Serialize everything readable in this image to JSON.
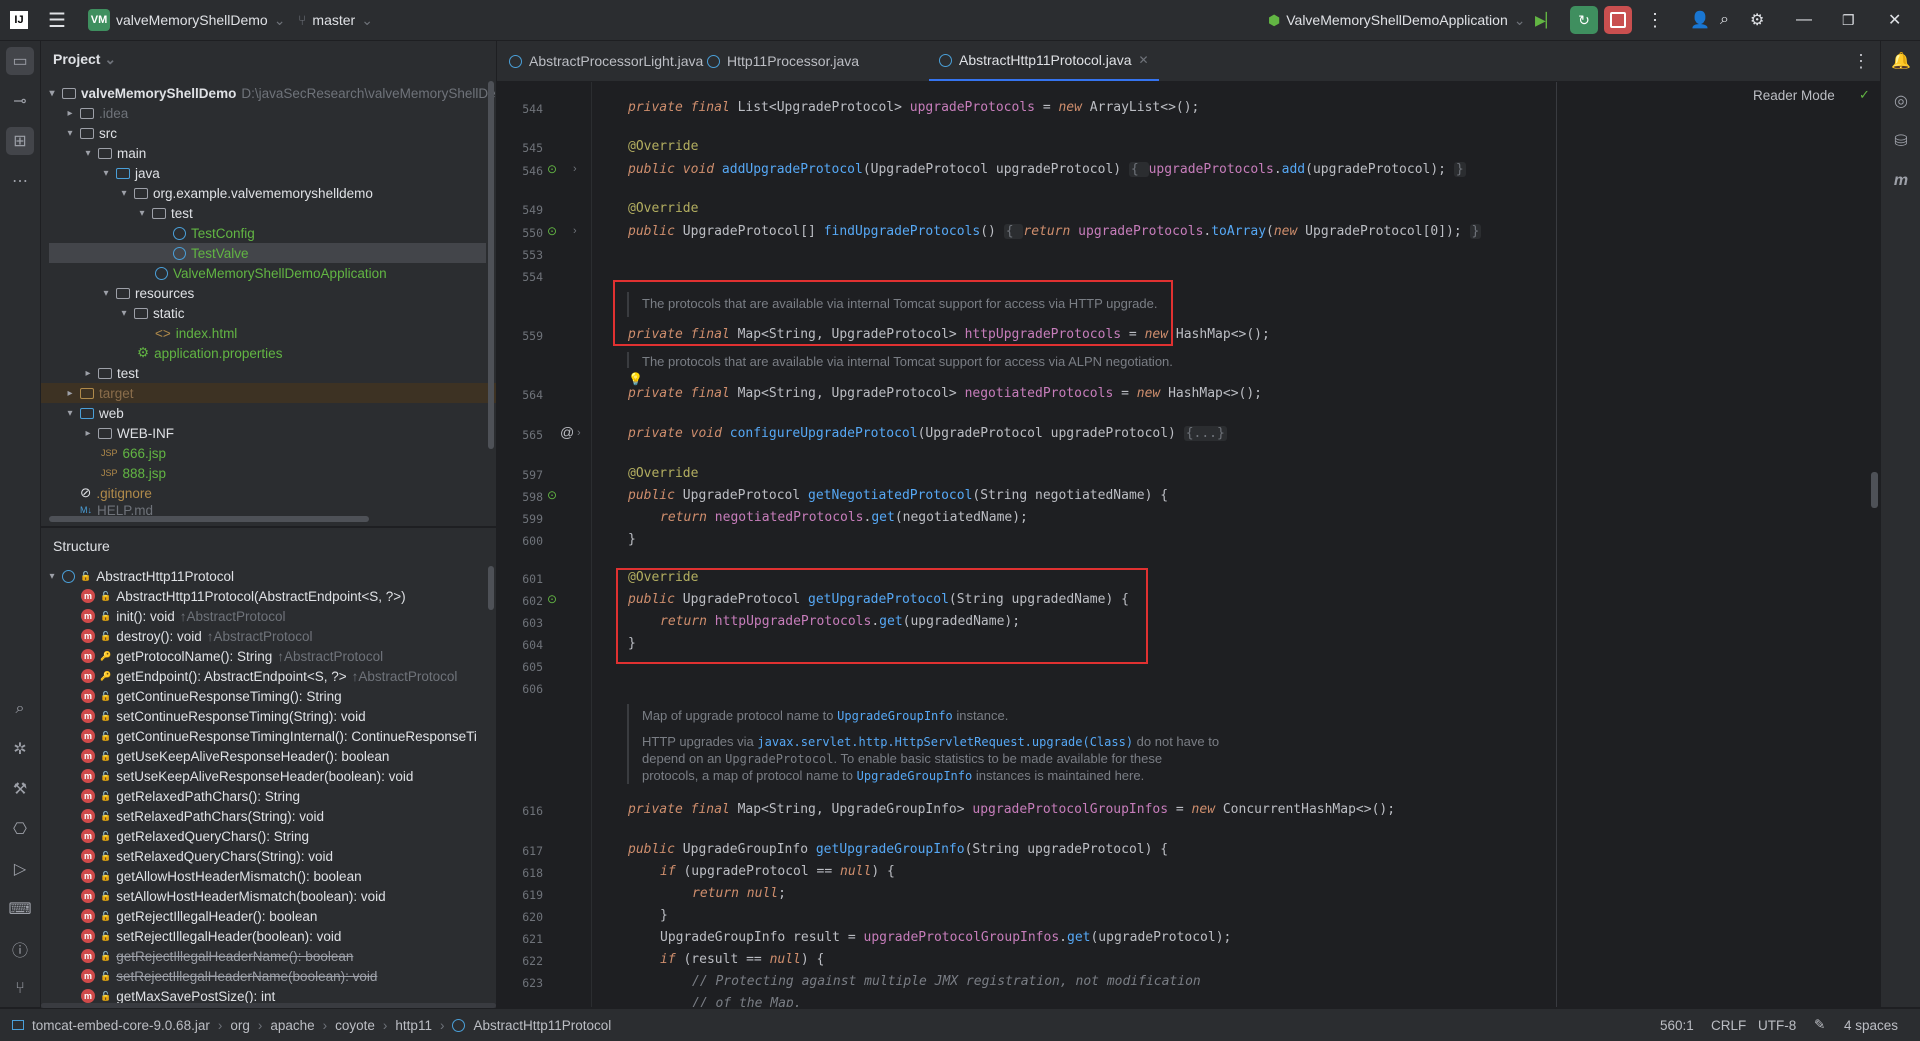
{
  "titlebar": {
    "project_badge": "VM",
    "project_name": "valveMemoryShellDemo",
    "branch": "master",
    "run_config": "ValveMemoryShellDemoApplication"
  },
  "project_panel": {
    "title": "Project",
    "rows": [
      {
        "label": "valveMemoryShellDemo",
        "extra": "D:\\javaSecResearch\\valveMemoryShellDe"
      },
      {
        "label": ".idea"
      },
      {
        "label": "src"
      },
      {
        "label": "main"
      },
      {
        "label": "java"
      },
      {
        "label": "org.example.valvememoryshelldemo"
      },
      {
        "label": "test"
      },
      {
        "label": "TestConfig"
      },
      {
        "label": "TestValve"
      },
      {
        "label": "ValveMemoryShellDemoApplication"
      },
      {
        "label": "resources"
      },
      {
        "label": "static"
      },
      {
        "label": "index.html"
      },
      {
        "label": "application.properties"
      },
      {
        "label": "test"
      },
      {
        "label": "target"
      },
      {
        "label": "web"
      },
      {
        "label": "WEB-INF"
      },
      {
        "label": "666.jsp"
      },
      {
        "label": "888.jsp"
      },
      {
        "label": ".gitignore"
      },
      {
        "label": "HELP.md"
      }
    ]
  },
  "structure_panel": {
    "title": "Structure",
    "root": "AbstractHttp11Protocol",
    "items": [
      {
        "label": "AbstractHttp11Protocol(AbstractEndpoint<S, ?>)",
        "inherit": ""
      },
      {
        "label": "init(): void",
        "inherit": "↑AbstractProtocol"
      },
      {
        "label": "destroy(): void",
        "inherit": "↑AbstractProtocol"
      },
      {
        "label": "getProtocolName(): String",
        "inherit": "↑AbstractProtocol"
      },
      {
        "label": "getEndpoint(): AbstractEndpoint<S, ?>",
        "inherit": "↑AbstractProtocol"
      },
      {
        "label": "getContinueResponseTiming(): String",
        "inherit": ""
      },
      {
        "label": "setContinueResponseTiming(String): void",
        "inherit": ""
      },
      {
        "label": "getContinueResponseTimingInternal(): ContinueResponseTi",
        "inherit": ""
      },
      {
        "label": "getUseKeepAliveResponseHeader(): boolean",
        "inherit": ""
      },
      {
        "label": "setUseKeepAliveResponseHeader(boolean): void",
        "inherit": ""
      },
      {
        "label": "getRelaxedPathChars(): String",
        "inherit": ""
      },
      {
        "label": "setRelaxedPathChars(String): void",
        "inherit": ""
      },
      {
        "label": "getRelaxedQueryChars(): String",
        "inherit": ""
      },
      {
        "label": "setRelaxedQueryChars(String): void",
        "inherit": ""
      },
      {
        "label": "getAllowHostHeaderMismatch(): boolean",
        "inherit": ""
      },
      {
        "label": "setAllowHostHeaderMismatch(boolean): void",
        "inherit": ""
      },
      {
        "label": "getRejectIllegalHeader(): boolean",
        "inherit": ""
      },
      {
        "label": "setRejectIllegalHeader(boolean): void",
        "inherit": ""
      },
      {
        "label": "getRejectIllegalHeaderName(): boolean",
        "inherit": ""
      },
      {
        "label": "setRejectIllegalHeaderName(boolean): void",
        "inherit": ""
      },
      {
        "label": "getMaxSavePostSize(): int",
        "inherit": ""
      }
    ]
  },
  "tabs": [
    {
      "label": "AbstractProcessorLight.java"
    },
    {
      "label": "Http11Processor.java"
    },
    {
      "label": "AbstractHttp11Protocol.java"
    }
  ],
  "editor": {
    "reader_mode": "Reader Mode",
    "line_numbers": [
      "544",
      "545",
      "546",
      "549",
      "550",
      "553",
      "554",
      "559",
      "564",
      "565",
      "597",
      "598",
      "599",
      "600",
      "601",
      "602",
      "603",
      "604",
      "605",
      "606",
      "616",
      "617",
      "618",
      "619",
      "620",
      "621",
      "622",
      "623"
    ],
    "lines": {
      "l544a": "private final ",
      "l544b": "List<UpgradeProtocol> ",
      "l544c": "upgradeProtocols",
      "l544d": " = ",
      "l544e": "new ",
      "l544f": "ArrayList<>();",
      "l545": "@Override",
      "l546a": "public void ",
      "l546b": "addUpgradeProtocol",
      "l546c": "(UpgradeProtocol upgradeProtocol) ",
      "l546d": "{ ",
      "l546e": "upgradeProtocols",
      "l546f": ".",
      "l546g": "add",
      "l546h": "(upgradeProtocol); ",
      "l546i": "}",
      "l549": "@Override",
      "l550a": "public ",
      "l550b": "UpgradeProtocol[] ",
      "l550c": "findUpgradeProtocols",
      "l550d": "() ",
      "l550e": "{ ",
      "l550f": "return ",
      "l550g": "upgradeProtocols",
      "l550h": ".",
      "l550i": "toArray",
      "l550j": "(",
      "l550k": "new ",
      "l550l": "UpgradeProtocol[0]); ",
      "l550m": "}",
      "doc559": "The protocols that are available via internal Tomcat support for access via HTTP upgrade.",
      "l559a": "private final ",
      "l559b": "Map<String, UpgradeProtocol> ",
      "l559c": "httpUpgradeProtocols",
      "l559d": " = ",
      "l559e": "new ",
      "l559f": "HashMap<>();",
      "doc564": "The protocols that are available via internal Tomcat support for access via ALPN negotiation.",
      "l564a": "private final ",
      "l564b": "Map<String, UpgradeProtocol> ",
      "l564c": "negotiatedProtocols",
      "l564d": " = ",
      "l564e": "new ",
      "l564f": "HashMap<>();",
      "l565a": "private void ",
      "l565b": "configureUpgradeProtocol",
      "l565c": "(UpgradeProtocol upgradeProtocol) ",
      "l565d": "{...}",
      "l597": "@Override",
      "l598a": "public ",
      "l598b": "UpgradeProtocol ",
      "l598c": "getNegotiatedProtocol",
      "l598d": "(String negotiatedName) {",
      "l599a": "return ",
      "l599b": "negotiatedProtocols",
      "l599c": ".",
      "l599d": "get",
      "l599e": "(negotiatedName);",
      "l600": "}",
      "l601": "@Override",
      "l602a": "public ",
      "l602b": "UpgradeProtocol ",
      "l602c": "getUpgradeProtocol",
      "l602d": "(String upgradedName) {",
      "l603a": "return ",
      "l603b": "httpUpgradeProtocols",
      "l603c": ".",
      "l603d": "get",
      "l603e": "(upgradedName);",
      "l604": "}",
      "doc_a1": "Map of upgrade protocol name to ",
      "doc_a2": "UpgradeGroupInfo",
      "doc_a3": " instance.",
      "doc_b1": "HTTP upgrades via ",
      "doc_b2": "javax.servlet.http.HttpServletRequest.upgrade(Class)",
      "doc_b3": " do not have to",
      "doc_c1": "depend on an ",
      "doc_c2": "UpgradeProtocol",
      "doc_c3": ". To enable basic statistics to be made available for these",
      "doc_d1": "protocols, a map of protocol name to ",
      "doc_d2": "UpgradeGroupInfo",
      "doc_d3": " instances is maintained here.",
      "l616a": "private final ",
      "l616b": "Map<String, UpgradeGroupInfo> ",
      "l616c": "upgradeProtocolGroupInfos",
      "l616d": " = ",
      "l616e": "new ",
      "l616f": "ConcurrentHashMap<>();",
      "l617a": "public ",
      "l617b": "UpgradeGroupInfo ",
      "l617c": "getUpgradeGroupInfo",
      "l617d": "(String upgradeProtocol) {",
      "l618a": "if ",
      "l618b": "(upgradeProtocol == ",
      "l618c": "null",
      "l618d": ") {",
      "l619a": "return ",
      "l619b": "null",
      "l619c": ";",
      "l620": "}",
      "l621a": "UpgradeGroupInfo result = ",
      "l621b": "upgradeProtocolGroupInfos",
      "l621c": ".",
      "l621d": "get",
      "l621e": "(upgradeProtocol);",
      "l622a": "if ",
      "l622b": "(result == ",
      "l622c": "null",
      "l622d": ") {",
      "l623": "// Protecting against multiple JMX registration, not modification",
      "l624": "// of the Map."
    }
  },
  "statusbar": {
    "breadcrumbs": [
      "tomcat-embed-core-9.0.68.jar",
      "org",
      "apache",
      "coyote",
      "http11",
      "AbstractHttp11Protocol"
    ],
    "position": "560:1",
    "line_sep": "CRLF",
    "encoding": "UTF-8",
    "indent": "4 spaces"
  }
}
